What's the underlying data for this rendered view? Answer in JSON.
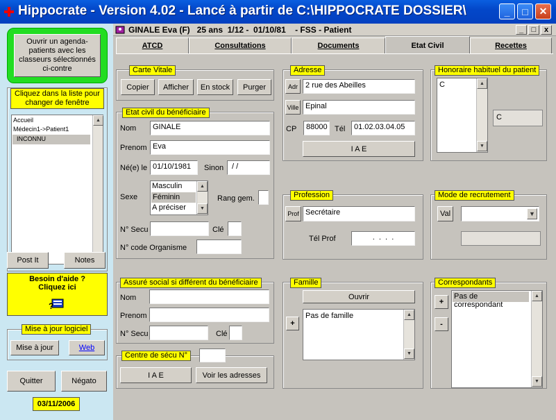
{
  "window": {
    "title": "Hippocrate - Version 4.02 - Lancé à partir de C:\\HIPPOCRATE DOSSIER\\",
    "min": "_",
    "max": "□",
    "close": "✕"
  },
  "sidebar": {
    "agenda_button": "Ouvrir un agenda-patients avec les classeurs sélectionnés ci-contre",
    "list_header": "Cliquez dans la liste pour changer de fenêtre",
    "list_items": [
      "Accueil",
      "Médecin1->Patient1",
      "INCONNU"
    ],
    "postit": "Post It",
    "notes": "Notes",
    "help_line1": "Besoin d'aide ?",
    "help_line2": "Cliquez ici",
    "update_group": "Mise à jour logiciel",
    "update_button": "Mise à jour",
    "web_link": "Web",
    "quit": "Quitter",
    "negato": "Négato",
    "date": "03/11/2006"
  },
  "patient": {
    "header": "GINALE Eva (F)   25 ans  1/12 -  01/10/81    - FSS - Patient",
    "min": "_",
    "max": "□",
    "close": "x"
  },
  "tabs": [
    "ATCD",
    "Consultations",
    "Documents",
    "Etat Civil",
    "Recettes"
  ],
  "carte_vitale": {
    "label": "Carte Vitale",
    "buttons": [
      "Copier",
      "Afficher",
      "En stock",
      "Purger"
    ]
  },
  "etat_civil": {
    "label": "Etat civil du bénéficiaire",
    "nom_label": "Nom",
    "nom": "GINALE",
    "prenom_label": "Prenom",
    "prenom": "Eva",
    "ne_label": "Né(e) le",
    "dob": "01/10/1981",
    "sinon_label": "Sinon",
    "sinon": " / /",
    "sexe_label": "Sexe",
    "sexe_options": [
      "Masculin",
      "Féminin",
      "A préciser"
    ],
    "rang_label": "Rang gem.",
    "secu_label": "N° Secu",
    "cle_label": "Clé",
    "organisme_label": "N° code Organisme"
  },
  "adresse": {
    "label": "Adresse",
    "adr_btn": "Adr",
    "adr": "2 rue des Abeilles",
    "ville_btn": "Ville",
    "ville": "Epinal",
    "cp_label": "CP",
    "cp": "88000",
    "tel_label": "Tél",
    "tel": "01.02.03.04.05",
    "iae": "I A E"
  },
  "honoraire": {
    "label": "Honoraire habituel du patient",
    "list_item": "C",
    "value": "C"
  },
  "profession": {
    "label": "Profession",
    "prof_btn": "Prof",
    "value": "Secrétaire",
    "tel_label": "Tél Prof",
    "tel": ".  .  .  ."
  },
  "recrutement": {
    "label": "Mode de recrutement",
    "val_btn": "Val"
  },
  "assure": {
    "label": "Assuré social  si différent du bénéficiaire",
    "nom_label": "Nom",
    "prenom_label": "Prenom",
    "secu_label": "N° Secu",
    "cle_label": "Clé"
  },
  "centre": {
    "label": "Centre de sécu  N°",
    "iae": "I A E",
    "voir": "Voir les adresses"
  },
  "famille": {
    "label": "Famille",
    "ouvrir": "Ouvrir",
    "plus": "+",
    "list_item": "Pas de famille"
  },
  "correspondants": {
    "label": "Correspondants",
    "plus": "+",
    "minus": "-",
    "list_item": "Pas de correspondant"
  }
}
